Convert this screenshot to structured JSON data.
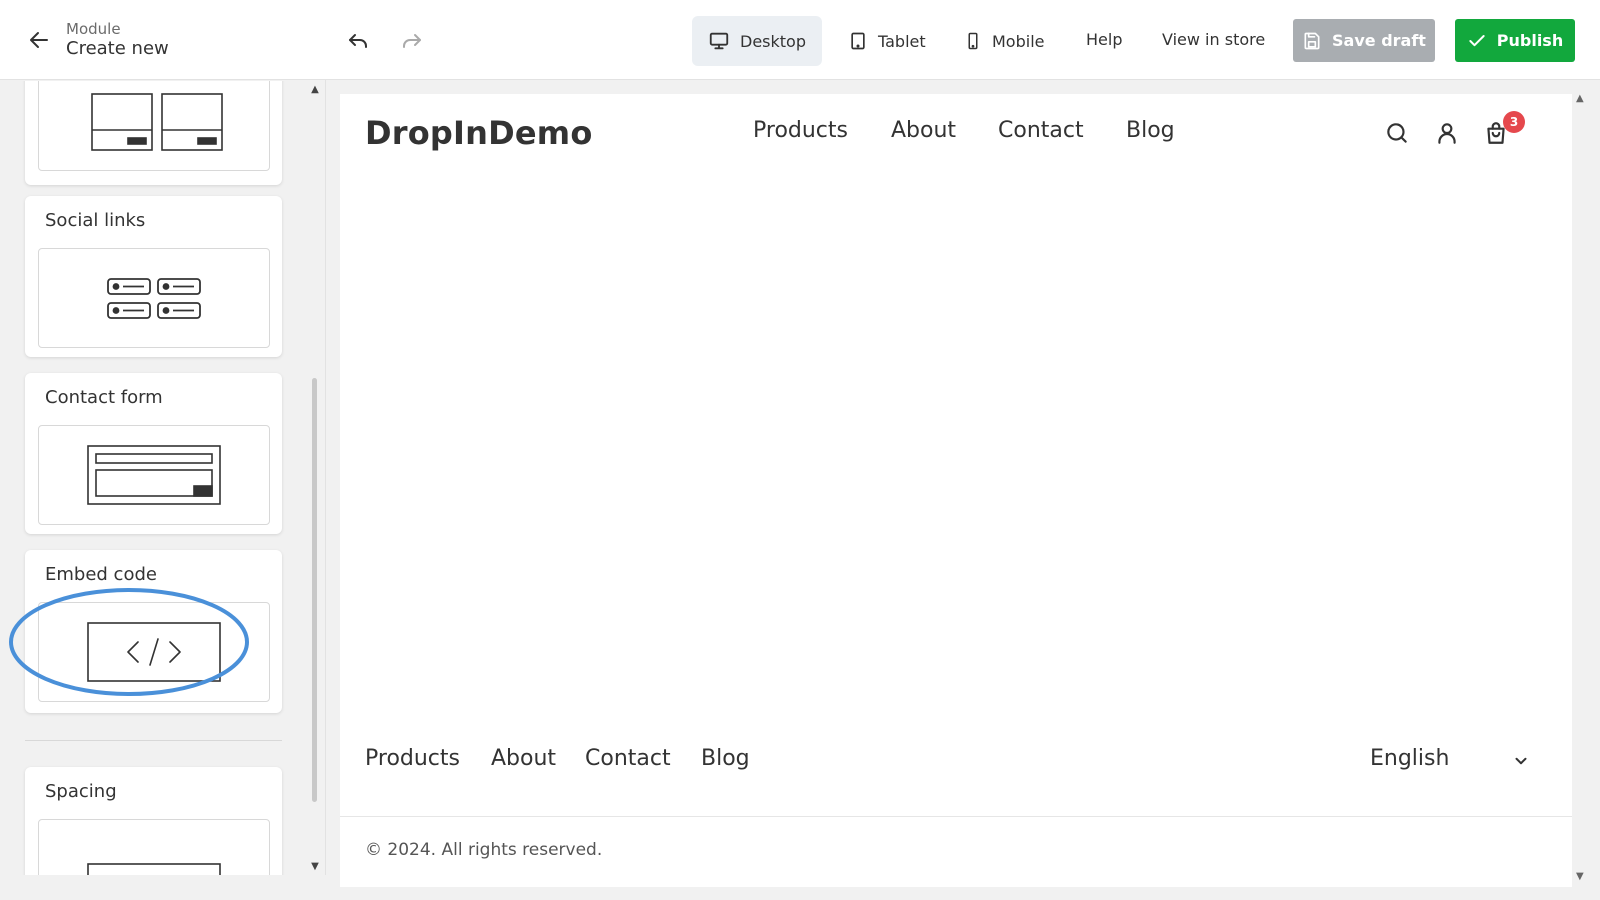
{
  "header": {
    "subtitle": "Module",
    "title": "Create new"
  },
  "sidebar": {
    "cards": [
      {
        "title": ""
      },
      {
        "title": "Social links"
      },
      {
        "title": "Contact form"
      },
      {
        "title": "Embed code"
      },
      {
        "title": "Spacing"
      }
    ]
  },
  "toolbar": {
    "devices": [
      "Desktop",
      "Tablet",
      "Mobile"
    ],
    "active_device": "Desktop",
    "help_label": "Help",
    "view_store_label": "View in store",
    "save_label": "Save draft",
    "publish_label": "Publish"
  },
  "store": {
    "logo": "DropInDemo",
    "nav": [
      "Products",
      "About",
      "Contact",
      "Blog"
    ],
    "cart_count": "3",
    "footer_links": [
      "Products",
      "About",
      "Contact",
      "Blog"
    ],
    "language": "English",
    "copyright": "© 2024. All rights reserved."
  },
  "colors": {
    "publish": "#12a83d",
    "save_disabled": "#a9adb1",
    "highlight": "#4a90d9",
    "badge": "#e5484d"
  }
}
